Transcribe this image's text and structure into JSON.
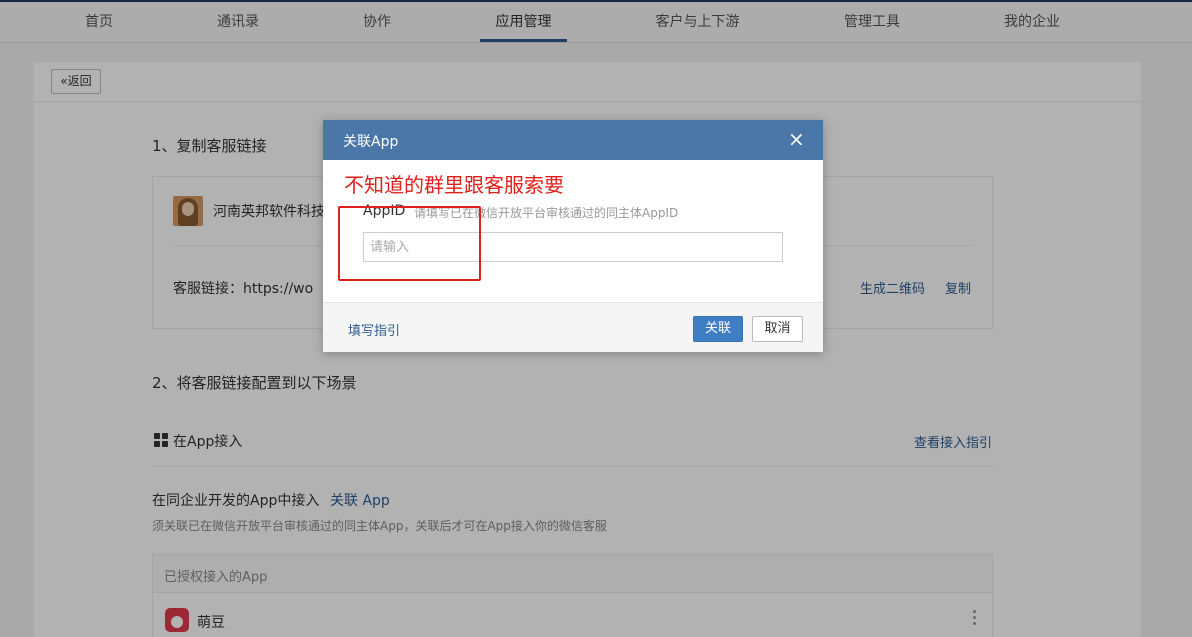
{
  "nav": {
    "items": [
      "首页",
      "通讯录",
      "协作",
      "应用管理",
      "客户与上下游",
      "管理工具",
      "我的企业"
    ],
    "active": "应用管理"
  },
  "page": {
    "back_label": "返回",
    "section1_title": "1、复制客服链接",
    "company_name": "河南英邦软件科技",
    "link_label": "客服链接：https://wo",
    "gen_qr_label": "生成二维码",
    "copy_label": "复制",
    "section2_title": "2、将客服链接配置到以下场景",
    "app_access_label": "在App接入",
    "view_guide_label": "查看接入指引",
    "same_corp_label": "在同企业开发的App中接入",
    "link_app_label": "关联 App",
    "hint_text": "须关联已在微信开放平台审核通过的同主体App，关联后才可在App接入你的微信客服",
    "authorized_label": "已授权接入的App",
    "app_name": "萌豆"
  },
  "dialog": {
    "title": "关联App",
    "close_icon": "×",
    "annotation": "不知道的群里跟客服索要",
    "appid_label": "AppID",
    "appid_help": "请填写已在微信开放平台审核通过的同主体AppID",
    "appid_placeholder": "请输入",
    "appid_value": "",
    "guide_label": "填写指引",
    "ok_label": "关联",
    "cancel_label": "取消"
  },
  "colors": {
    "accent": "#2d5b94",
    "dialog_header": "#4a76a8",
    "annotation_red": "#e0201a",
    "primary_button": "#3f7dc4"
  },
  "icons": [
    "double-chevron-left-icon",
    "grid-icon",
    "close-icon",
    "kebab-icon"
  ]
}
